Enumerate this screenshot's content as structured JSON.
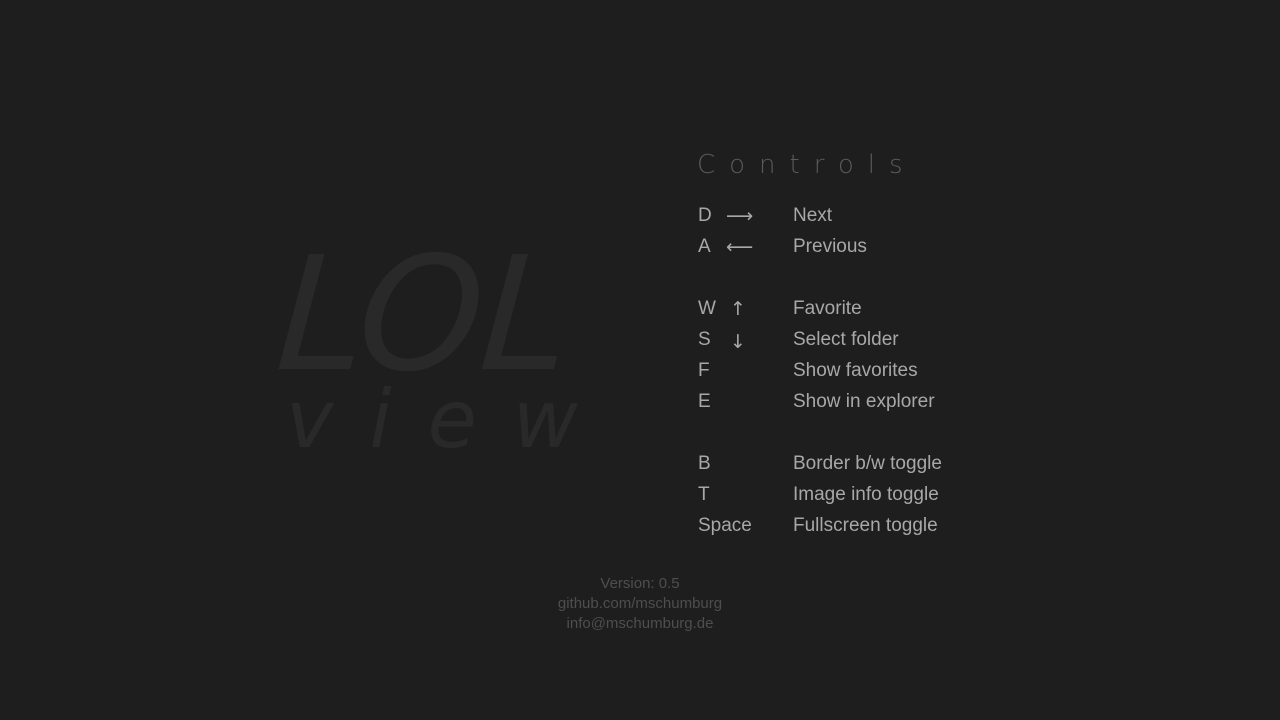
{
  "logo": {
    "line1": "LOL",
    "line2": "view"
  },
  "controls": {
    "title": "Controls",
    "rows": [
      {
        "key": "D",
        "arrow": "⟶",
        "arrow_icon": "arrow-right-icon",
        "action": "Next"
      },
      {
        "key": "A",
        "arrow": "⟵",
        "arrow_icon": "arrow-left-icon",
        "action": "Previous"
      },
      {
        "key": "W",
        "arrow": "↑",
        "arrow_icon": "arrow-up-icon",
        "action": "Favorite"
      },
      {
        "key": "S",
        "arrow": "↓",
        "arrow_icon": "arrow-down-icon",
        "action": "Select folder"
      },
      {
        "key": "F",
        "arrow": "",
        "action": "Show favorites"
      },
      {
        "key": "E",
        "arrow": "",
        "action": "Show in explorer"
      },
      {
        "key": "B",
        "arrow": "",
        "action": "Border b/w toggle"
      },
      {
        "key": "T",
        "arrow": "",
        "action": "Image info toggle"
      },
      {
        "key": "Space",
        "arrow": "",
        "action": "Fullscreen toggle"
      }
    ]
  },
  "footer": {
    "version": "Version: 0.5",
    "github": "github.com/mschumburg",
    "email": "info@mschumburg.de"
  },
  "colors": {
    "background": "#1e1e1e",
    "logo": "#292929",
    "text": "#a8a8a8",
    "title": "#5a5a5a",
    "footer": "#4e4e4e"
  }
}
